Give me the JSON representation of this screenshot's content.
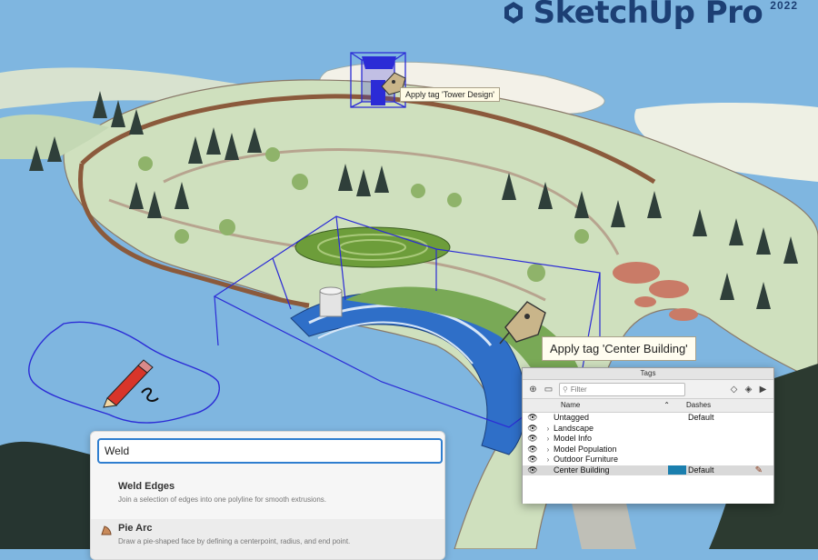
{
  "brand": {
    "name": "SketchUp Pro",
    "version": "2022"
  },
  "tooltips": {
    "tower": "Apply tag 'Tower Design'",
    "center": "Apply tag 'Center Building'"
  },
  "tags_panel": {
    "title": "Tags",
    "filter_placeholder": "Filter",
    "columns": {
      "name": "Name",
      "dashes": "Dashes"
    },
    "rows": [
      {
        "name": "Untagged",
        "expandable": false,
        "dashes": "Default",
        "selected": false
      },
      {
        "name": "Landscape",
        "expandable": true,
        "dashes": "",
        "selected": false
      },
      {
        "name": "Model Info",
        "expandable": true,
        "dashes": "",
        "selected": false
      },
      {
        "name": "Model Population",
        "expandable": true,
        "dashes": "",
        "selected": false
      },
      {
        "name": "Outdoor Furniture",
        "expandable": true,
        "dashes": "",
        "selected": false
      },
      {
        "name": "Center Building",
        "expandable": false,
        "dashes": "Default",
        "selected": true,
        "color": "#1b7fae"
      }
    ]
  },
  "search_panel": {
    "query": "Weld",
    "results": [
      {
        "title": "Weld Edges",
        "description": "Join a selection of edges into one polyline for smooth extrusions.",
        "icon": "weld-icon"
      },
      {
        "title": "Pie Arc",
        "description": "Draw a pie-shaped face by defining a centerpoint, radius, and end point.",
        "icon": "pie-arc-icon"
      }
    ]
  },
  "colors": {
    "water": "#7fb6e0",
    "accent": "#2f7ecf",
    "selection": "#2b2bd6",
    "tag_color": "#1b7fae"
  }
}
